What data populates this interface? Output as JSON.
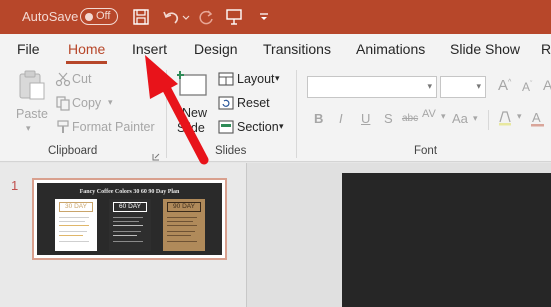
{
  "titlebar": {
    "autosave_label": "AutoSave",
    "toggle_state": "Off",
    "icons": [
      "save-icon",
      "undo-icon",
      "redo-icon",
      "present-icon",
      "customize-qat-icon"
    ]
  },
  "tabs": [
    "File",
    "Home",
    "Insert",
    "Design",
    "Transitions",
    "Animations",
    "Slide Show",
    "R"
  ],
  "active_tab": "Home",
  "ribbon": {
    "clipboard": {
      "paste": "Paste",
      "cut": "Cut",
      "copy": "Copy",
      "format_painter": "Format Painter",
      "group_label": "Clipboard"
    },
    "slides": {
      "new_slide_line1": "New",
      "new_slide_line2": "Slide",
      "layout": "Layout",
      "reset": "Reset",
      "section": "Section",
      "group_label": "Slides"
    },
    "font": {
      "font_name": "",
      "font_size": "",
      "bold": "B",
      "italic": "I",
      "underline": "U",
      "strikethrough": "S",
      "shadow": "abc",
      "spacing": "AV",
      "change_case": "Aa",
      "group_label": "Font"
    }
  },
  "slides_pane": {
    "slide_number": "1",
    "thumbnail": {
      "title": "Fancy Coffee Colors 30 60 90 Day Plan",
      "columns": [
        "30 DAY",
        "60 DAY",
        "90 DAY"
      ]
    }
  },
  "colors": {
    "accent": "#b7472a",
    "annotation_arrow": "#e8131a"
  }
}
